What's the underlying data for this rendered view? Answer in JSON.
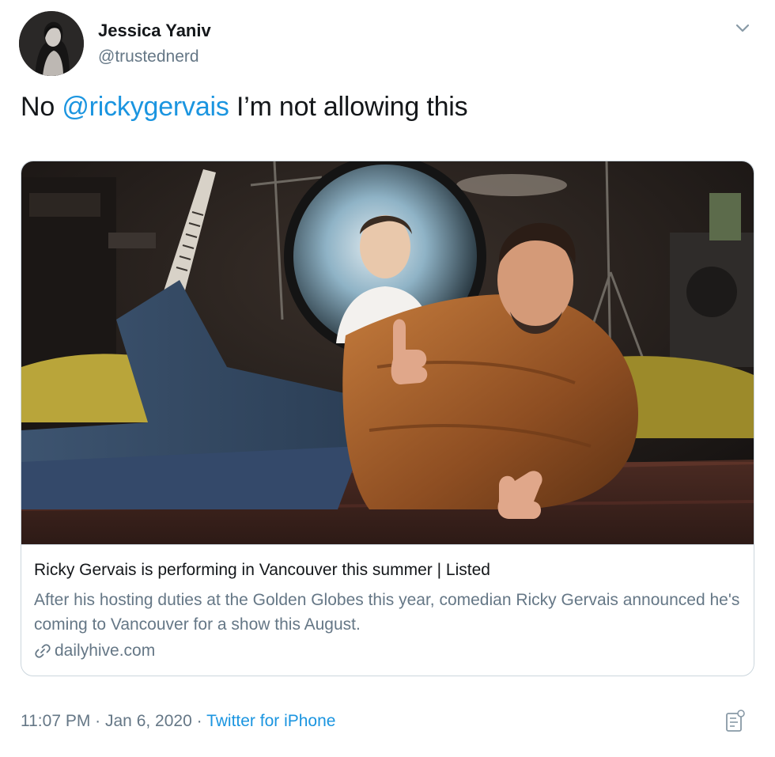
{
  "author": {
    "display_name": "Jessica Yaniv",
    "handle": "@trustednerd"
  },
  "tweet": {
    "text_before": "No ",
    "mention": "@rickygervais",
    "text_after": " I’m not allowing this"
  },
  "card": {
    "title": "Ricky Gervais is performing in Vancouver this summer | Listed",
    "description": "After his hosting duties at the Golden Globes this year, comedian Ricky Gervais announced he's coming to Vancouver for a show this August.",
    "domain": "dailyhive.com"
  },
  "footer": {
    "time": "11:07 PM",
    "separator_1": " · ",
    "date": "Jan 6, 2020",
    "separator_2": " · ",
    "source": "Twitter for iPhone"
  },
  "icons": {
    "caret": "chevron-down-icon",
    "link": "link-icon",
    "analytics": "analytics-icon"
  },
  "colors": {
    "link_blue": "#1b95e0",
    "secondary_text": "#657786",
    "primary_text": "#14171a",
    "border": "#ccd6dd"
  }
}
